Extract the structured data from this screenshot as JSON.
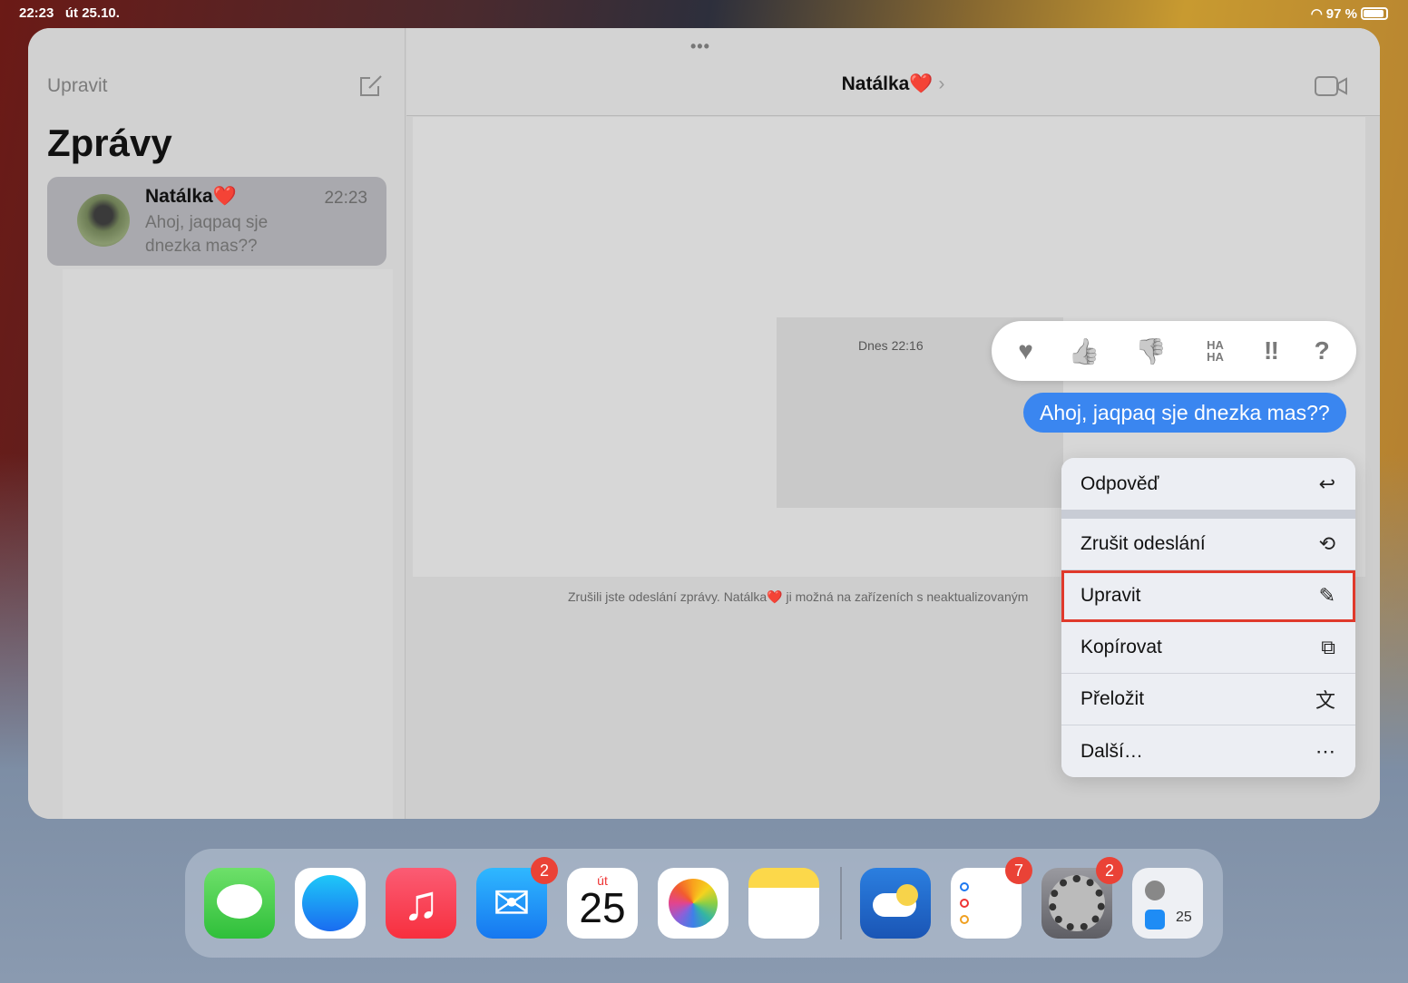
{
  "status_bar": {
    "time": "22:23",
    "date": "út 25.10.",
    "battery": "97 %"
  },
  "sidebar": {
    "edit": "Upravit",
    "title": "Zprávy",
    "conversations": [
      {
        "name": "Natálka❤️",
        "time": "22:23",
        "preview": "Ahoj, jaqpaq sje dnezka mas??"
      }
    ]
  },
  "chat": {
    "name": "Natálka❤️",
    "timestamp": "Dnes 22:16",
    "message": "Ahoj, jaqpaq sje dnezka mas??",
    "notice": "Zrušili jste odeslání zprávy. Natálka❤️ ji možná na zařízeních s neaktualizovaným"
  },
  "tapbacks": [
    "♥",
    "👍",
    "👎",
    "HA HA",
    "‼",
    "?"
  ],
  "menu": [
    {
      "label": "Odpověď",
      "icon": "↩"
    },
    {
      "label": "Zrušit odeslání",
      "icon": "⟲"
    },
    {
      "label": "Upravit",
      "icon": "✎"
    },
    {
      "label": "Kopírovat",
      "icon": "⧉"
    },
    {
      "label": "Přeložit",
      "icon": "文"
    },
    {
      "label": "Další…",
      "icon": "⋯"
    }
  ],
  "dock": {
    "mail_badge": "2",
    "calendar_day": "út",
    "calendar_date": "25",
    "reminders_badge": "7",
    "settings_badge": "2",
    "recent_date": "25"
  }
}
